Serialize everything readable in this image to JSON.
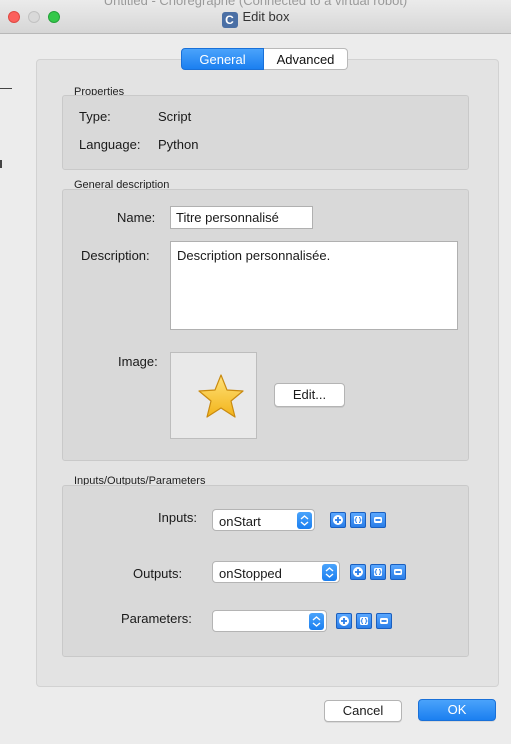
{
  "window": {
    "background_title": "Untitled - Choregraphe (Connected to a virtual robot)",
    "title": "Edit box",
    "app_icon_letter": "C"
  },
  "tabs": [
    {
      "label": "General",
      "selected": true
    },
    {
      "label": "Advanced",
      "selected": false
    }
  ],
  "properties": {
    "group_label": "Properties",
    "type_label": "Type:",
    "type_value": "Script",
    "language_label": "Language:",
    "language_value": "Python"
  },
  "general_description": {
    "group_label": "General description",
    "name_label": "Name:",
    "name_value": "Titre personnalisé",
    "description_label": "Description:",
    "description_value": "Description personnalisée.",
    "image_label": "Image:",
    "image_icon": "star-icon",
    "edit_button": "Edit..."
  },
  "io": {
    "group_label": "Inputs/Outputs/Parameters",
    "inputs_label": "Inputs:",
    "inputs_selected": "onStart",
    "outputs_label": "Outputs:",
    "outputs_selected": "onStopped",
    "parameters_label": "Parameters:",
    "parameters_selected": ""
  },
  "footer": {
    "cancel_label": "Cancel",
    "ok_label": "OK"
  },
  "colors": {
    "accent": "#1b7ff0",
    "star": "#f7c531"
  }
}
